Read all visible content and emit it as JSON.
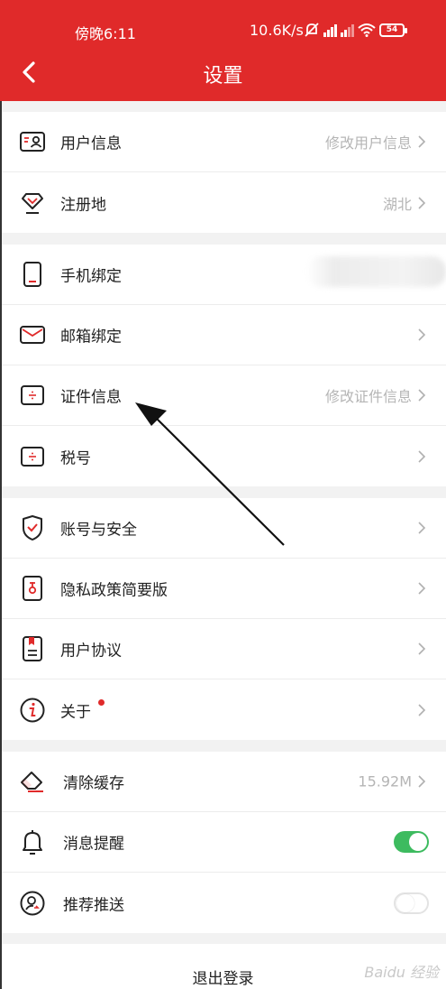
{
  "status_bar": {
    "time": "傍晚6:11",
    "speed": "10.6K/s",
    "battery": "54"
  },
  "header": {
    "title": "设置"
  },
  "groups": [
    {
      "rows": [
        {
          "label": "用户信息",
          "value": "修改用户信息"
        },
        {
          "label": "注册地",
          "value": "湖北"
        }
      ]
    },
    {
      "rows": [
        {
          "label": "手机绑定",
          "value": ""
        },
        {
          "label": "邮箱绑定",
          "value": ""
        },
        {
          "label": "证件信息",
          "value": "修改证件信息"
        },
        {
          "label": "税号",
          "value": ""
        }
      ]
    },
    {
      "rows": [
        {
          "label": "账号与安全",
          "value": ""
        },
        {
          "label": "隐私政策简要版",
          "value": ""
        },
        {
          "label": "用户协议",
          "value": ""
        },
        {
          "label": "关于",
          "value": ""
        }
      ]
    },
    {
      "rows": [
        {
          "label": "清除缓存",
          "value": "15.92M"
        },
        {
          "label": "消息提醒",
          "toggle": true
        },
        {
          "label": "推荐推送",
          "toggle": false
        }
      ]
    }
  ],
  "logout": {
    "label": "退出登录"
  },
  "watermark": "Baidu 经验",
  "colors": {
    "brand": "#e02a2a",
    "toggle_on": "#3dbb5f"
  }
}
